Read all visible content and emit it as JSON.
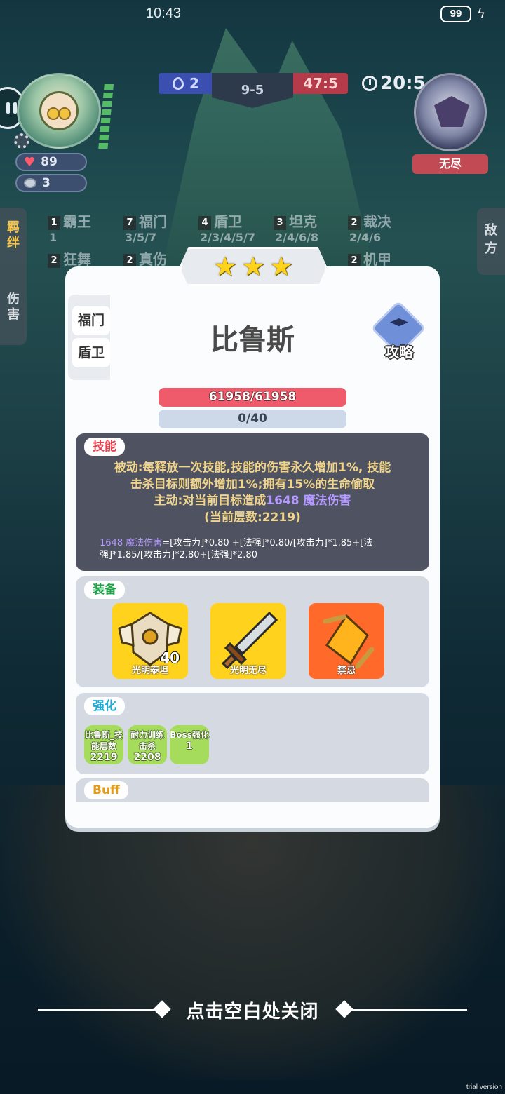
{
  "status_bar": {
    "time": "10:43",
    "battery": "99"
  },
  "hud": {
    "blue_score": "2",
    "round": "9-5",
    "red_score": "47:5",
    "timer": "20:5",
    "player": {
      "hp": "89",
      "gold": "3"
    },
    "enemy": {
      "name": "无尽"
    }
  },
  "side_tabs": {
    "left_top": "羁绊",
    "left_bottom": "伤害",
    "right": "敌方"
  },
  "traits": [
    {
      "count": "1",
      "name": "霸王",
      "tiers": "1"
    },
    {
      "count": "7",
      "name": "福门",
      "tiers": "3/5/7"
    },
    {
      "count": "4",
      "name": "盾卫",
      "tiers": "2/3/4/5/7"
    },
    {
      "count": "3",
      "name": "坦克",
      "tiers": "2/4/6/8"
    },
    {
      "count": "2",
      "name": "裁决",
      "tiers": "2/4/6"
    },
    {
      "count": "2",
      "name": "狂舞",
      "tiers": ""
    },
    {
      "count": "2",
      "name": "真伤",
      "tiers": ""
    },
    {
      "count": "2",
      "name": "机甲",
      "tiers": ""
    }
  ],
  "modal": {
    "star_count": 3,
    "trait_tags": [
      "福门",
      "盾卫"
    ],
    "hero_name": "比鲁斯",
    "guide_label": "攻略",
    "hp": "61958/61958",
    "mana": "0/40",
    "skill": {
      "tag": "技能",
      "line1": "被动:每释放一次技能,技能的伤害永久增加1%, 技能",
      "line2": "击杀目标则额外增加1%;拥有15%的生命偷取",
      "line3_prefix": "主动:对当前目标造成",
      "line3_highlight": "1648 魔法伤害",
      "line4": "(当前层数:2219)",
      "formula_highlight": "1648 魔法伤害",
      "formula_rest": "=[攻击力]*0.80 +[法强]*0.80/[攻击力]*1.85+[法强]*1.85/[攻击力]*2.80+[法强]*2.80"
    },
    "equipment": {
      "tag": "装备",
      "items": [
        {
          "name": "光明泰坦",
          "stack": "40",
          "bg": "#ffd21e"
        },
        {
          "name": "光明无尽",
          "stack": "",
          "bg": "#ffd21e"
        },
        {
          "name": "禁忌",
          "stack": "",
          "bg": "#ff6a2a"
        }
      ]
    },
    "enhance": {
      "tag": "强化",
      "chips": [
        {
          "label": "比鲁斯_技能层数",
          "value": "2219"
        },
        {
          "label": "耐力训练击杀",
          "value": "2208"
        },
        {
          "label": "Boss强化",
          "value": "1"
        }
      ]
    },
    "buff": {
      "tag": "Buff"
    }
  },
  "close_hint": "点击空白处关闭",
  "watermark": "trial version",
  "colors": {
    "hp": "#ef5b6a",
    "mana": "#cdd9e8",
    "skill_bg": "#4f5260",
    "highlight": "#b59bff"
  }
}
